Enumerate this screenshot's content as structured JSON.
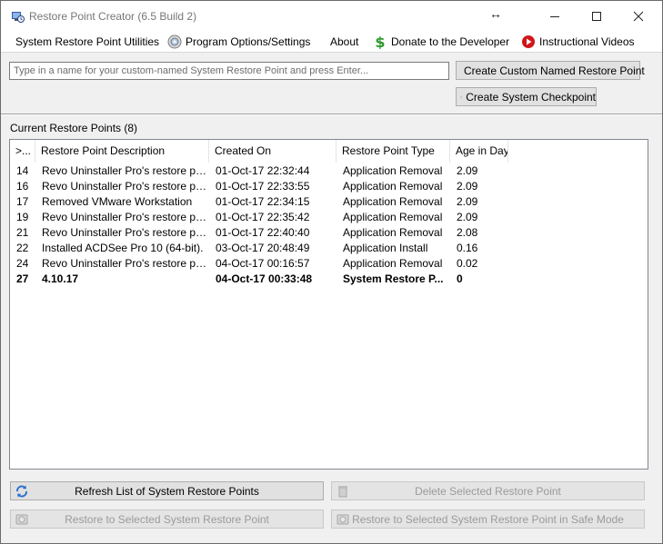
{
  "window": {
    "title": "Restore Point Creator (6.5 Build 2)",
    "icons": {
      "app": "restore-app-icon",
      "resize": "resize-arrows-icon"
    }
  },
  "menu": {
    "items": [
      {
        "label": "System Restore Point Utilities",
        "icon": ""
      },
      {
        "label": "Program Options/Settings",
        "icon": "settings-disc-icon"
      },
      {
        "label": "About",
        "icon": ""
      },
      {
        "label": "Donate to the Developer",
        "icon": "dollar-icon"
      },
      {
        "label": "Instructional Videos",
        "icon": "play-icon"
      }
    ]
  },
  "create": {
    "input_value": "",
    "input_placeholder": "Type in a name for your custom-named System Restore Point and press Enter...",
    "custom_button": "Create Custom Named Restore Point",
    "checkpoint_button": "Create System Checkpoint"
  },
  "list": {
    "group_label": "Current Restore Points (8)",
    "columns": [
      ">...",
      "Restore Point Description",
      "Created On",
      "Restore Point Type",
      "Age in Days"
    ],
    "rows": [
      {
        "id": "14",
        "desc": "Revo Uninstaller Pro's restore point ...",
        "created": "01-Oct-17 22:32:44",
        "type": "Application Removal",
        "age": "2.09",
        "bold": false
      },
      {
        "id": "16",
        "desc": "Revo Uninstaller Pro's restore point ...",
        "created": "01-Oct-17 22:33:55",
        "type": "Application Removal",
        "age": "2.09",
        "bold": false
      },
      {
        "id": "17",
        "desc": "Removed VMware Workstation",
        "created": "01-Oct-17 22:34:15",
        "type": "Application Removal",
        "age": "2.09",
        "bold": false
      },
      {
        "id": "19",
        "desc": "Revo Uninstaller Pro's restore point ...",
        "created": "01-Oct-17 22:35:42",
        "type": "Application Removal",
        "age": "2.09",
        "bold": false
      },
      {
        "id": "21",
        "desc": "Revo Uninstaller Pro's restore point ...",
        "created": "01-Oct-17 22:40:40",
        "type": "Application Removal",
        "age": "2.08",
        "bold": false
      },
      {
        "id": "22",
        "desc": "Installed ACDSee Pro 10 (64-bit).",
        "created": "03-Oct-17 20:48:49",
        "type": "Application Install",
        "age": "0.16",
        "bold": false
      },
      {
        "id": "24",
        "desc": "Revo Uninstaller Pro's restore point ...",
        "created": "04-Oct-17 00:16:57",
        "type": "Application Removal",
        "age": "0.02",
        "bold": false
      },
      {
        "id": "27",
        "desc": "4.10.17",
        "created": "04-Oct-17 00:33:48",
        "type": "System Restore P...",
        "age": "0",
        "bold": true
      }
    ]
  },
  "actions": {
    "refresh": "Refresh List of System Restore Points",
    "delete": "Delete Selected Restore Point",
    "restore": "Restore to Selected System Restore Point",
    "restore_safe": "Restore to Selected System Restore Point in Safe Mode"
  }
}
